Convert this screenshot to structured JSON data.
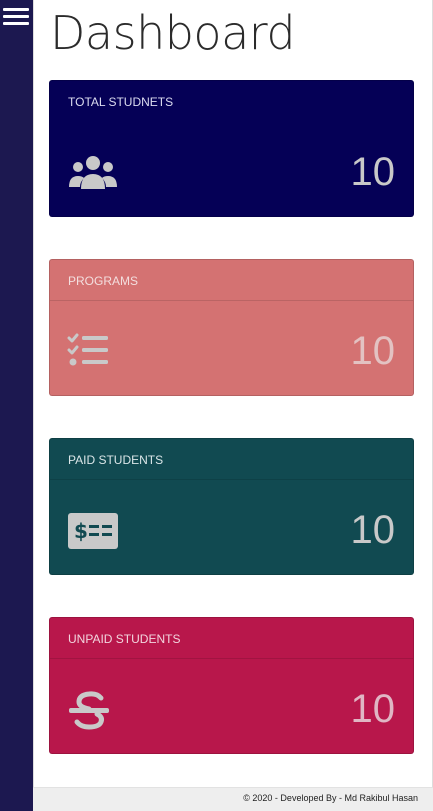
{
  "page": {
    "title": "Dashboard"
  },
  "colors": {
    "sidebar": "#1c1850",
    "total_students": "#050056",
    "programs": "#d47272",
    "paid_students": "#114a51",
    "unpaid_students": "#b8174b",
    "icon_and_value": "#c9c9c9"
  },
  "cards": [
    {
      "label": "TOTAL STUDNETS",
      "value": "10",
      "icon": "users-icon"
    },
    {
      "label": "PROGRAMS",
      "value": "10",
      "icon": "checklist-icon"
    },
    {
      "label": "PAID STUDENTS",
      "value": "10",
      "icon": "money-check-icon"
    },
    {
      "label": "UNPAID STUDENTS",
      "value": "10",
      "icon": "strikethrough-s-icon"
    }
  ],
  "footer": {
    "text": "© 2020 - Developed By - Md Rakibul Hasan"
  }
}
